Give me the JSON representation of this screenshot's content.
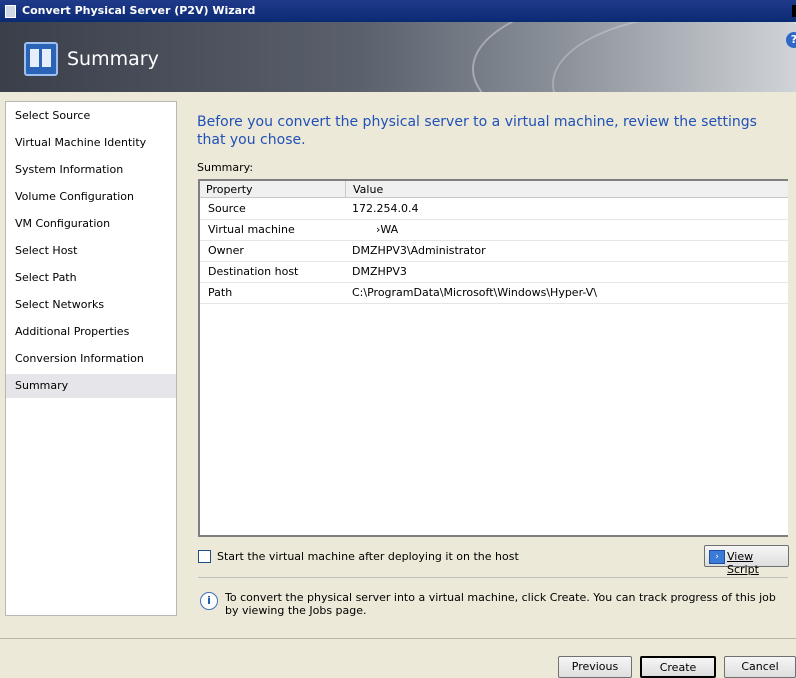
{
  "window": {
    "title": "Convert Physical Server (P2V) Wizard"
  },
  "header": {
    "title": "Summary",
    "help_icon": "help-icon"
  },
  "nav": {
    "items": [
      {
        "label": "Select Source"
      },
      {
        "label": "Virtual Machine Identity"
      },
      {
        "label": "System Information"
      },
      {
        "label": "Volume Configuration"
      },
      {
        "label": "VM Configuration"
      },
      {
        "label": "Select Host"
      },
      {
        "label": "Select Path"
      },
      {
        "label": "Select Networks"
      },
      {
        "label": "Additional Properties"
      },
      {
        "label": "Conversion Information"
      },
      {
        "label": "Summary",
        "active": true
      }
    ]
  },
  "main": {
    "lead": "Before you convert the physical server to a virtual machine, review the settings that you chose.",
    "summary_label": "Summary:",
    "table": {
      "columns": [
        "Property",
        "Value"
      ],
      "rows": [
        {
          "property": "Source",
          "value": "172.254.0.4"
        },
        {
          "property": "Virtual machine",
          "value": "›WA"
        },
        {
          "property": "Owner",
          "value": "DMZHPV3\\Administrator"
        },
        {
          "property": "Destination host",
          "value": "DMZHPV3"
        },
        {
          "property": "Path",
          "value": "C:\\ProgramData\\Microsoft\\Windows\\Hyper-V\\"
        }
      ]
    },
    "start_vm_checkbox": {
      "label": "Start the virtual machine after deploying it on the host",
      "checked": false
    },
    "view_script_label": "View Script",
    "info_text": "To convert the physical server into a virtual machine, click Create.  You can track progress of this job by viewing the Jobs page."
  },
  "footer": {
    "previous_label": "Previous",
    "create_label": "Create",
    "cancel_label": "Cancel"
  }
}
